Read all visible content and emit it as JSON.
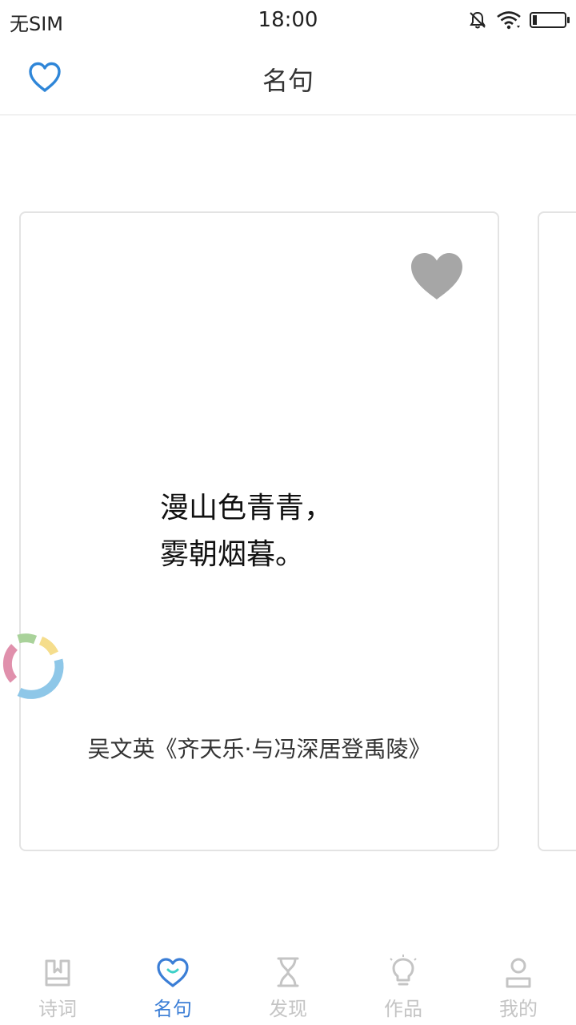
{
  "status_bar": {
    "carrier": "无SIM",
    "time": "18:00"
  },
  "header": {
    "title": "名句",
    "fav_icon": "heart-outline-icon"
  },
  "card": {
    "quote_lines": [
      "漫山色青青，",
      "雾朝烟暮。"
    ],
    "source": "吴文英《齐天乐·与冯深居登禹陵》",
    "fav_icon": "heart-filled-icon"
  },
  "tabs": [
    {
      "label": "诗词",
      "icon": "book-icon",
      "active": false
    },
    {
      "label": "名句",
      "icon": "heart-tab-icon",
      "active": true
    },
    {
      "label": "发现",
      "icon": "hourglass-icon",
      "active": false
    },
    {
      "label": "作品",
      "icon": "lightbulb-icon",
      "active": false
    },
    {
      "label": "我的",
      "icon": "person-icon",
      "active": false
    }
  ],
  "colors": {
    "accent": "#3b7ed6",
    "tab_inactive": "#c4c4c4",
    "card_heart": "#a6a6a6",
    "header_heart": "#2f86d8"
  }
}
